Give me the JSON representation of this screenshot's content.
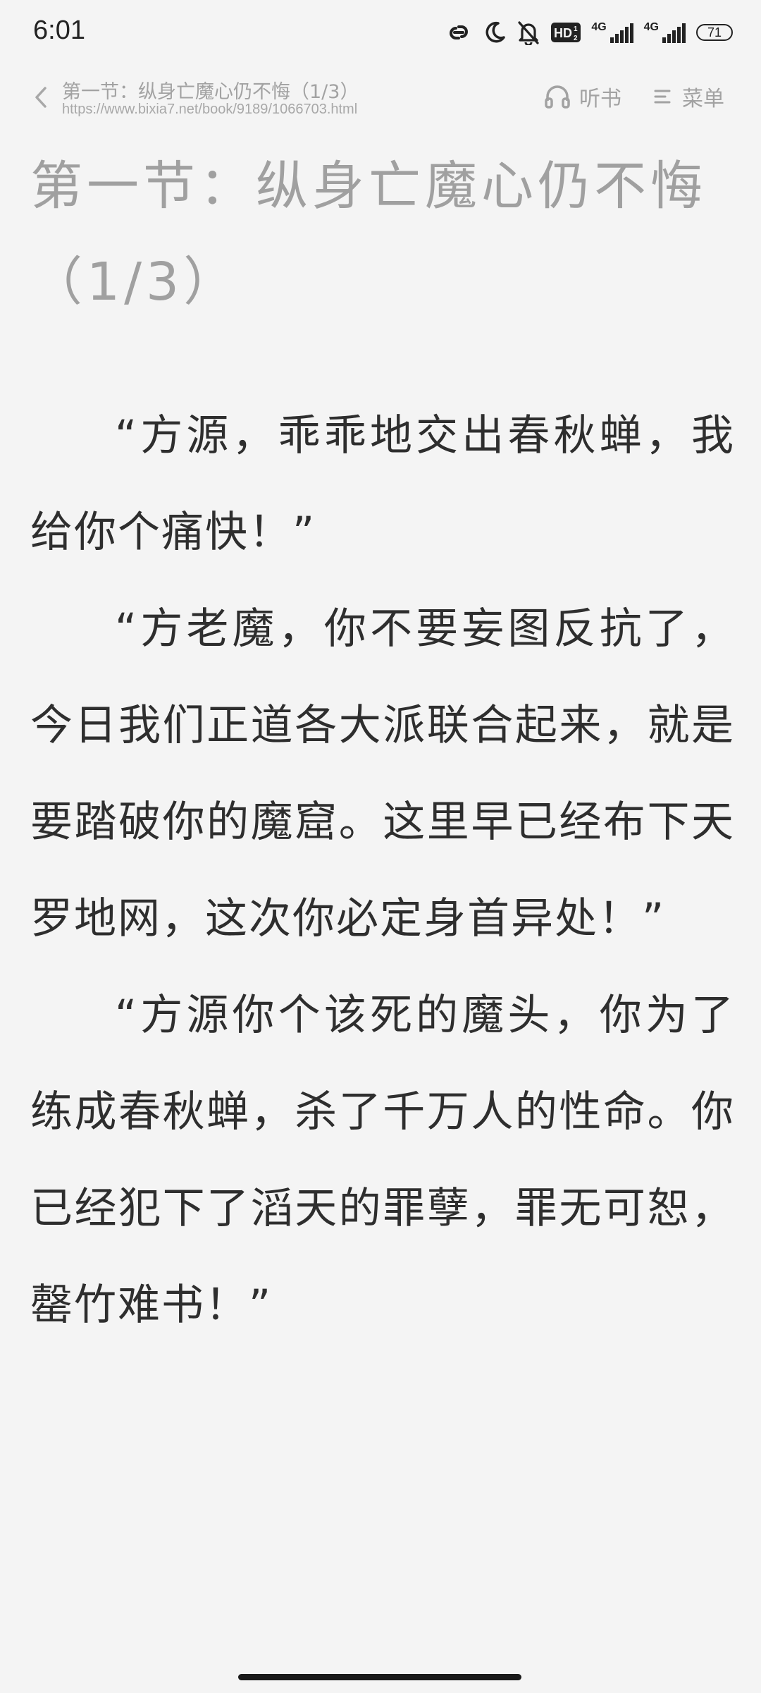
{
  "status_bar": {
    "time": "6:01",
    "icons": [
      "link-icon",
      "moon-icon",
      "bell-off-icon",
      "hd-icon",
      "signal-4g-icon",
      "signal-4g-icon",
      "battery-icon"
    ],
    "hd_label": "HD",
    "signal1_label": "4G",
    "signal2_label": "4G",
    "battery_level": "71"
  },
  "header": {
    "title": "第一节：纵身亡魔心仍不悔（1/3）",
    "url": "https://www.bixia7.net/book/9189/1066703.html",
    "listen_label": "听书",
    "menu_label": "菜单",
    "icons": [
      "chevron-left-icon",
      "headphones-icon",
      "menu-icon"
    ]
  },
  "chapter": {
    "title": "第一节：纵身亡魔心仍不悔（1/3）"
  },
  "content": {
    "paragraphs": [
      "“方源，乖乖地交出春秋蝉，我给你个痛快！”",
      "“方老魔，你不要妄图反抗了，今日我们正道各大派联合起来，就是要踏破你的魔窟。这里早已经布下天罗地网，这次你必定身首异处！”",
      "“方源你个该死的魔头，你为了练成春秋蝉，杀了千万人的性命。你已经犯下了滔天的罪孽，罪无可恕，罄竹难书！”"
    ]
  },
  "colors": {
    "background": "#f4f4f4",
    "text": "#2e2e2e",
    "muted": "#a2a2a2"
  }
}
